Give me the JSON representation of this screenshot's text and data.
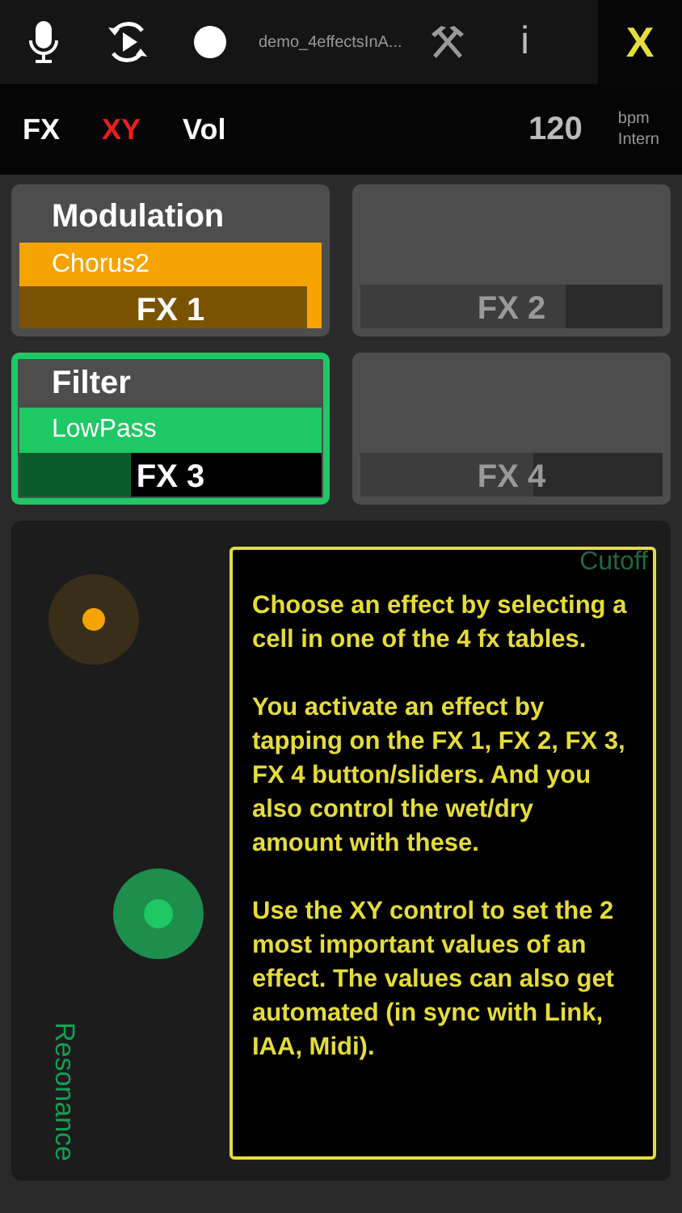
{
  "toolbar": {
    "file_name": "demo_4effectsInA...",
    "info": "i",
    "close": "X"
  },
  "modes": [
    {
      "label": "FX",
      "selected": false
    },
    {
      "label": "XY",
      "selected": true
    },
    {
      "label": "Vol",
      "selected": false
    }
  ],
  "tempo": {
    "value": "120",
    "unit": "bpm",
    "source": "Intern"
  },
  "slots": [
    {
      "kind": "assigned",
      "category": "Modulation",
      "effect": "Chorus2",
      "button": "FX 1",
      "color": "#f5a300",
      "selected": false,
      "level": 0.95
    },
    {
      "kind": "empty",
      "button": "FX 2",
      "selected": false,
      "level": 0.68
    },
    {
      "kind": "assigned",
      "category": "Filter",
      "effect": "LowPass",
      "button": "FX 3",
      "color": "#1ec864",
      "selected": true,
      "level": 0.37
    },
    {
      "kind": "empty",
      "button": "FX 4",
      "selected": false,
      "level": 0.57
    }
  ],
  "xy_pad": {
    "x_label": "Cutoff",
    "y_label": "Resonance",
    "handles": [
      {
        "color": "#f5a300"
      },
      {
        "color": "#1ec864"
      }
    ],
    "help": [
      "Choose an effect by selecting a cell in one of the 4 fx tables.",
      "You activate an effect by tapping on the FX 1, FX 2, FX 3, FX 4 button/sliders. And you also control the wet/dry amount with these.",
      "Use the XY control to set the 2 most important values of an effect. The values can also get automated (in sync with Link, IAA, Midi)."
    ]
  }
}
